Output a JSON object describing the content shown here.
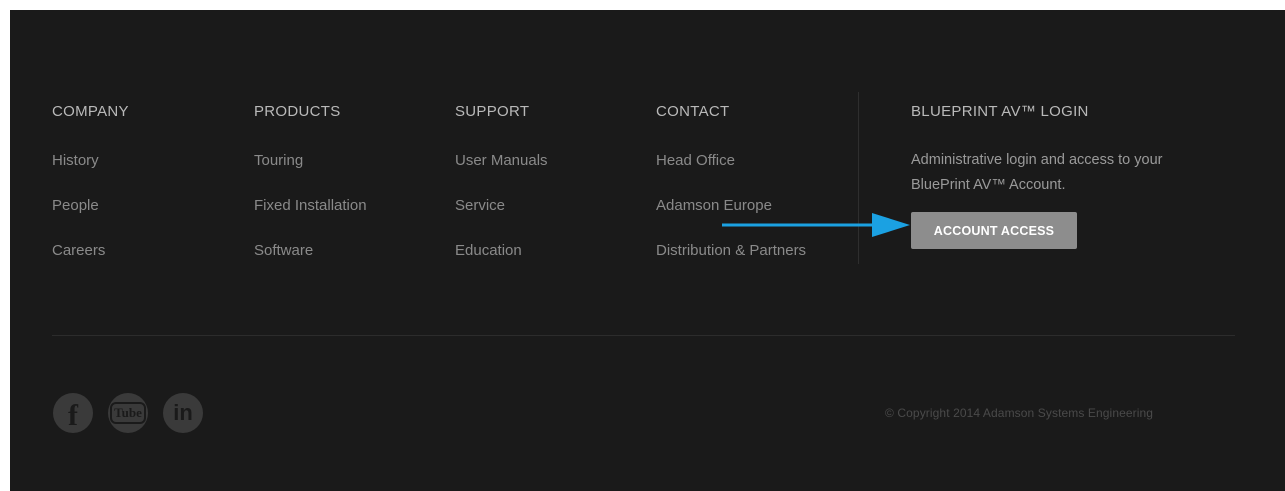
{
  "columns": [
    {
      "title": "COMPANY",
      "links": [
        "History",
        "People",
        "Careers"
      ]
    },
    {
      "title": "PRODUCTS",
      "links": [
        "Touring",
        "Fixed Installation",
        "Software"
      ]
    },
    {
      "title": "SUPPORT",
      "links": [
        "User Manuals",
        "Service",
        "Education"
      ]
    },
    {
      "title": "CONTACT",
      "links": [
        "Head Office",
        "Adamson Europe",
        "Distribution & Partners"
      ]
    }
  ],
  "login": {
    "title": "BLUEPRINT AV™ LOGIN",
    "description": "Administrative login and access to your BluePrint AV™ Account.",
    "button_label": "ACCOUNT ACCESS"
  },
  "social": {
    "facebook_glyph": "f",
    "youtube_glyph": "Tube",
    "linkedin_glyph": "in"
  },
  "copyright": "© Copyright 2014 Adamson Systems Engineering",
  "colors": {
    "background": "#1a1a1a",
    "arrow": "#1ba1e2",
    "button": "#8d8d8d"
  }
}
